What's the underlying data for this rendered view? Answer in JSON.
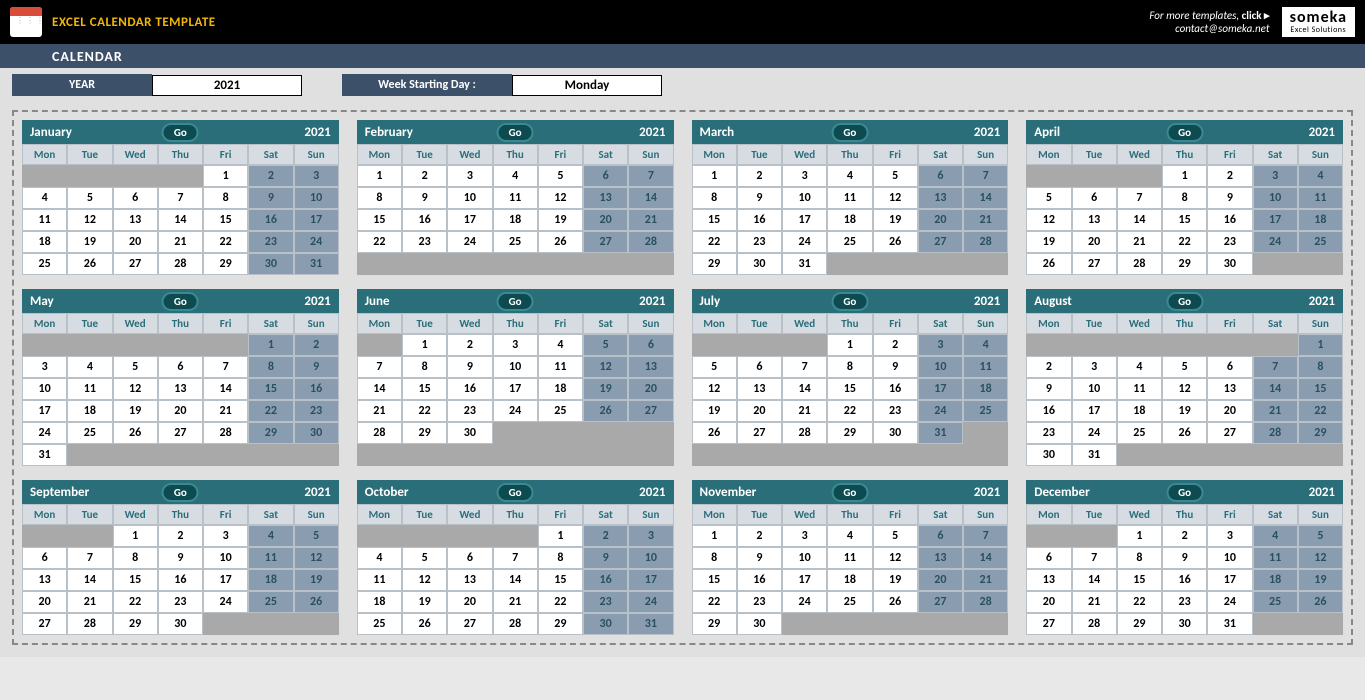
{
  "header": {
    "title": "EXCEL CALENDAR TEMPLATE",
    "subtitle": "CALENDAR",
    "more_text": "For more templates, ",
    "more_link": "click ▸",
    "contact": "contact@someka.net",
    "logo_line1": "someka",
    "logo_line2": "Excel Solutions"
  },
  "controls": {
    "year_label": "YEAR",
    "year_value": "2021",
    "wsd_label": "Week Starting Day :",
    "wsd_value": "Monday"
  },
  "weekdays": [
    "Mon",
    "Tue",
    "Wed",
    "Thu",
    "Fri",
    "Sat",
    "Sun"
  ],
  "go_label": "Go",
  "months": [
    {
      "name": "January",
      "year": "2021",
      "offset": 4,
      "days": 31
    },
    {
      "name": "February",
      "year": "2021",
      "offset": 0,
      "days": 28
    },
    {
      "name": "March",
      "year": "2021",
      "offset": 0,
      "days": 31
    },
    {
      "name": "April",
      "year": "2021",
      "offset": 3,
      "days": 30
    },
    {
      "name": "May",
      "year": "2021",
      "offset": 5,
      "days": 31
    },
    {
      "name": "June",
      "year": "2021",
      "offset": 1,
      "days": 30
    },
    {
      "name": "July",
      "year": "2021",
      "offset": 3,
      "days": 31
    },
    {
      "name": "August",
      "year": "2021",
      "offset": 6,
      "days": 31
    },
    {
      "name": "September",
      "year": "2021",
      "offset": 2,
      "days": 30
    },
    {
      "name": "October",
      "year": "2021",
      "offset": 4,
      "days": 31
    },
    {
      "name": "November",
      "year": "2021",
      "offset": 0,
      "days": 30
    },
    {
      "name": "December",
      "year": "2021",
      "offset": 2,
      "days": 31
    }
  ]
}
